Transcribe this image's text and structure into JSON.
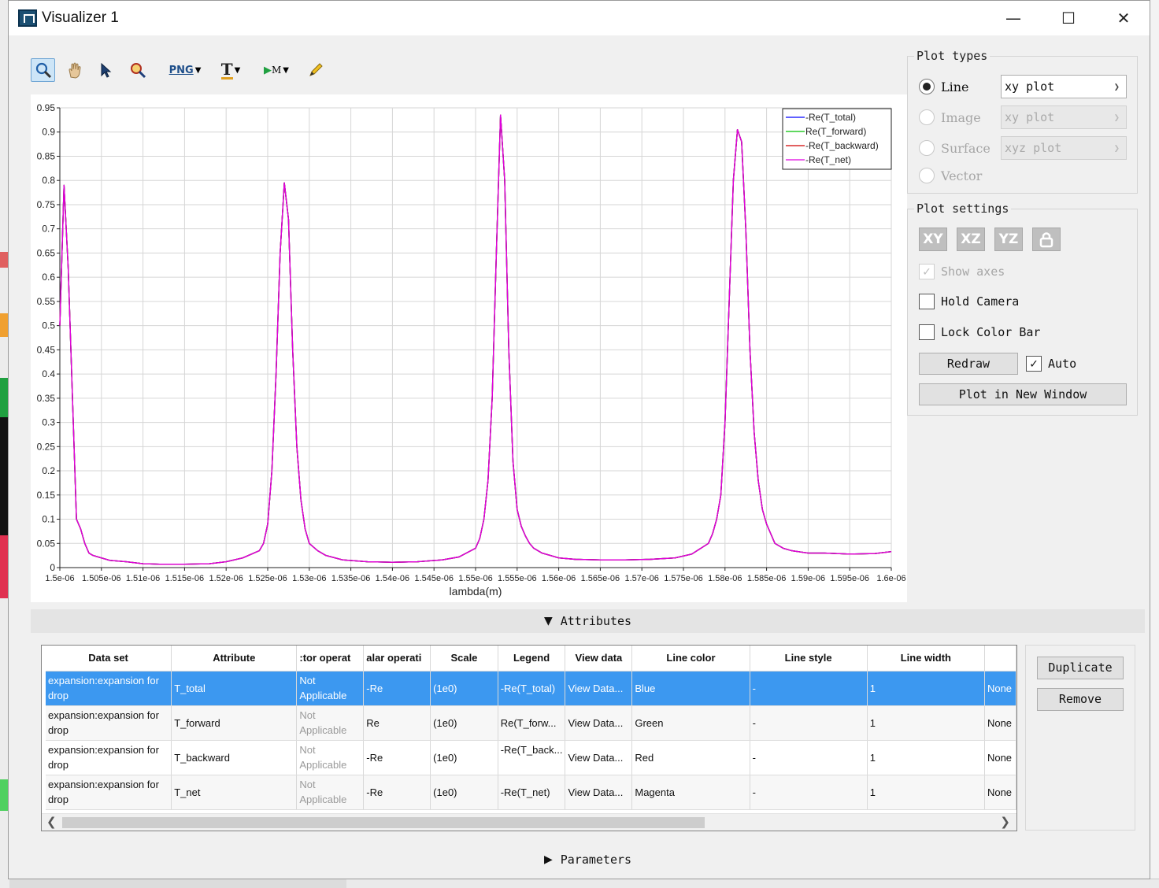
{
  "window": {
    "title": "Visualizer 1",
    "controls": {
      "minimize": "—",
      "maximize": "☐",
      "close": "✕"
    }
  },
  "toolbar": {
    "tools": [
      "zoom-tool",
      "pan-tool",
      "select-tool",
      "zoom-region-tool",
      "export-png",
      "text-tool",
      "marker-tool",
      "draw-tool"
    ],
    "png_label": "PNG",
    "text_label": "T",
    "marker_label": "M"
  },
  "chart_data": {
    "type": "line",
    "xlabel": "lambda(m)",
    "ylabel": "",
    "xlim": [
      1.5e-06,
      1.6e-06
    ],
    "ylim": [
      0,
      0.95
    ],
    "grid": true,
    "legend_position": "top-right",
    "x_tick_labels": [
      "1.5e-06",
      "1.505e-06",
      "1.51e-06",
      "1.515e-06",
      "1.52e-06",
      "1.525e-06",
      "1.53e-06",
      "1.535e-06",
      "1.54e-06",
      "1.545e-06",
      "1.55e-06",
      "1.555e-06",
      "1.56e-06",
      "1.565e-06",
      "1.57e-06",
      "1.575e-06",
      "1.58e-06",
      "1.585e-06",
      "1.59e-06",
      "1.595e-06",
      "1.6e-06"
    ],
    "y_tick_labels": [
      "0",
      "0.05",
      "0.1",
      "0.15",
      "0.2",
      "0.25",
      "0.3",
      "0.35",
      "0.4",
      "0.45",
      "0.5",
      "0.55",
      "0.6",
      "0.65",
      "0.7",
      "0.75",
      "0.8",
      "0.85",
      "0.9",
      "0.95"
    ],
    "x_um": [
      1.5,
      1.5005,
      1.501,
      1.502,
      1.5025,
      1.503,
      1.5035,
      1.504,
      1.505,
      1.506,
      1.508,
      1.51,
      1.512,
      1.515,
      1.518,
      1.52,
      1.522,
      1.524,
      1.5245,
      1.525,
      1.5255,
      1.526,
      1.5265,
      1.527,
      1.5275,
      1.528,
      1.5285,
      1.529,
      1.5295,
      1.53,
      1.531,
      1.532,
      1.534,
      1.537,
      1.54,
      1.543,
      1.546,
      1.548,
      1.55,
      1.5505,
      1.551,
      1.5515,
      1.552,
      1.5525,
      1.553,
      1.5535,
      1.554,
      1.5545,
      1.555,
      1.5555,
      1.556,
      1.5565,
      1.557,
      1.5575,
      1.558,
      1.559,
      1.56,
      1.562,
      1.565,
      1.568,
      1.571,
      1.574,
      1.576,
      1.578,
      1.5785,
      1.579,
      1.5795,
      1.58,
      1.5805,
      1.581,
      1.5815,
      1.582,
      1.5825,
      1.583,
      1.5835,
      1.584,
      1.5845,
      1.585,
      1.5855,
      1.586,
      1.587,
      1.588,
      1.59,
      1.592,
      1.595,
      1.598,
      1.6
    ],
    "series": [
      {
        "name": "-Re(T_total)",
        "color": "#0000ff"
      },
      {
        "name": "Re(T_forward)",
        "color": "#00c000"
      },
      {
        "name": "-Re(T_backward)",
        "color": "#d00000"
      },
      {
        "name": "-Re(T_net)",
        "color": "#e000e0"
      }
    ],
    "y": [
      0.5,
      0.79,
      0.62,
      0.1,
      0.08,
      0.05,
      0.03,
      0.025,
      0.02,
      0.015,
      0.012,
      0.008,
      0.007,
      0.007,
      0.008,
      0.012,
      0.02,
      0.035,
      0.05,
      0.09,
      0.2,
      0.4,
      0.65,
      0.795,
      0.72,
      0.45,
      0.25,
      0.14,
      0.08,
      0.05,
      0.035,
      0.025,
      0.016,
      0.012,
      0.011,
      0.012,
      0.016,
      0.022,
      0.04,
      0.06,
      0.1,
      0.18,
      0.35,
      0.65,
      0.935,
      0.8,
      0.45,
      0.22,
      0.12,
      0.085,
      0.065,
      0.05,
      0.04,
      0.035,
      0.03,
      0.025,
      0.02,
      0.017,
      0.016,
      0.016,
      0.017,
      0.02,
      0.028,
      0.05,
      0.07,
      0.1,
      0.15,
      0.3,
      0.55,
      0.8,
      0.905,
      0.88,
      0.7,
      0.45,
      0.28,
      0.18,
      0.12,
      0.09,
      0.07,
      0.05,
      0.04,
      0.035,
      0.03,
      0.03,
      0.028,
      0.029,
      0.033
    ]
  },
  "plot_types": {
    "title": "Plot types",
    "options": [
      {
        "label": "Line",
        "selected": true,
        "enabled": true,
        "combo": "xy plot"
      },
      {
        "label": "Image",
        "selected": false,
        "enabled": false,
        "combo": "xy plot"
      },
      {
        "label": "Surface",
        "selected": false,
        "enabled": false,
        "combo": "xyz plot"
      },
      {
        "label": "Vector",
        "selected": false,
        "enabled": false,
        "combo": ""
      }
    ]
  },
  "plot_settings": {
    "title": "Plot settings",
    "view_buttons": [
      "XY",
      "XZ",
      "YZ"
    ],
    "show_axes": {
      "label": "Show axes",
      "checked": true,
      "enabled": false
    },
    "hold_camera": {
      "label": "Hold Camera",
      "checked": false
    },
    "lock_color_bar": {
      "label": "Lock Color Bar",
      "checked": false
    },
    "redraw": "Redraw",
    "auto": {
      "label": "Auto",
      "checked": true
    },
    "plot_new_window": "Plot in New Window"
  },
  "attributes": {
    "header": "Attributes",
    "columns": [
      "Data set",
      "Attribute",
      ":tor operat",
      "alar operati",
      "Scale",
      "Legend",
      "View data",
      "Line color",
      "Line style",
      "Line width",
      ""
    ],
    "rows": [
      {
        "dataset": "expansion:expansion for drop",
        "attribute": "T_total",
        "vector_op": "Not Applicable",
        "scalar_op": "-Re",
        "scale": "(1e0)",
        "legend": "-Re(T_total)",
        "view": "View Data...",
        "color": "Blue",
        "style": "-",
        "width": "1",
        "extra": "None",
        "selected": true
      },
      {
        "dataset": "expansion:expansion for drop",
        "attribute": "T_forward",
        "vector_op": "Not Applicable",
        "scalar_op": "Re",
        "scale": "(1e0)",
        "legend": "Re(T_forw...",
        "view": "View Data...",
        "color": "Green",
        "style": "-",
        "width": "1",
        "extra": "None",
        "selected": false
      },
      {
        "dataset": "expansion:expansion for drop",
        "attribute": "T_backward",
        "vector_op": "Not Applicable",
        "scalar_op": "-Re",
        "scale": "(1e0)",
        "legend": "-Re(T_back...",
        "view": "View Data...",
        "color": "Red",
        "style": "-",
        "width": "1",
        "extra": "None",
        "selected": false
      },
      {
        "dataset": "expansion:expansion for drop",
        "attribute": "T_net",
        "vector_op": "Not Applicable",
        "scalar_op": "-Re",
        "scale": "(1e0)",
        "legend": "-Re(T_net)",
        "view": "View Data...",
        "color": "Magenta",
        "style": "-",
        "width": "1",
        "extra": "None",
        "selected": false
      }
    ],
    "duplicate": "Duplicate",
    "remove": "Remove"
  },
  "parameters": {
    "header": "Parameters"
  }
}
